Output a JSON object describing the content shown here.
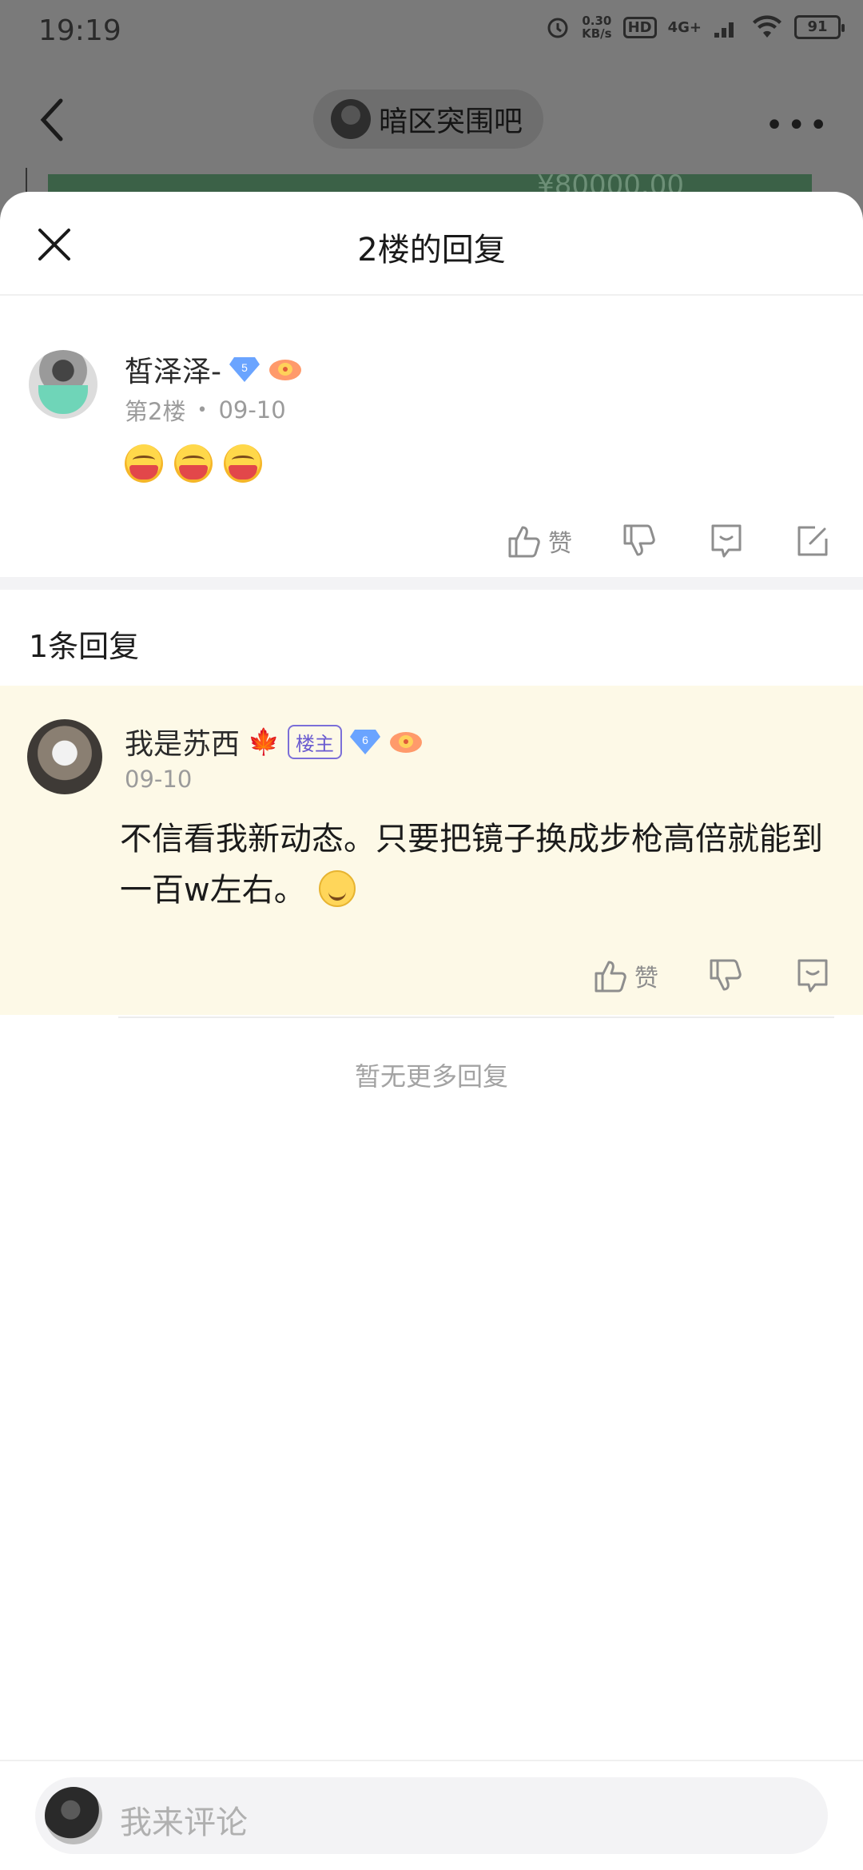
{
  "status_bar": {
    "time": "19:19",
    "net_speed": "0.30",
    "net_unit": "KB/s",
    "hd": "HD",
    "network": "4G+",
    "battery": "91"
  },
  "background": {
    "forum_name": "暗区突围吧",
    "price_partial": "¥80000.00"
  },
  "sheet": {
    "title": "2楼的回复"
  },
  "main_post": {
    "username": "皙泽泽-",
    "level": "5",
    "floor": "第2楼",
    "date": "09-10",
    "emoji_count": 3,
    "like_label": "赞"
  },
  "replies": {
    "count_label": "1条回复",
    "items": [
      {
        "username": "我是苏西",
        "leaf": "🍁",
        "op_badge": "楼主",
        "level": "6",
        "date": "09-10",
        "text": "不信看我新动态。只要把镜子换成步枪高倍就能到一百w左右。",
        "like_label": "赞"
      }
    ],
    "end_label": "暂无更多回复"
  },
  "bottom": {
    "placeholder": "我来评论"
  },
  "colors": {
    "accent_op": "#6a5bd0",
    "reply_highlight": "#fdf9e7",
    "level_badge": "#6aa4ff"
  }
}
